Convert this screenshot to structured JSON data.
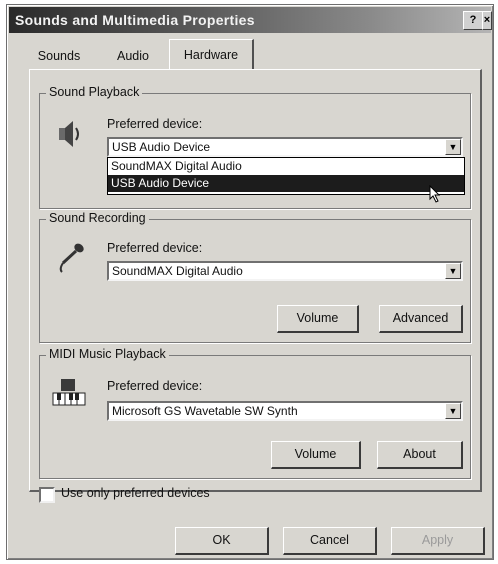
{
  "window": {
    "title": "Sounds and Multimedia Properties",
    "help_glyph": "?",
    "close_glyph": "×"
  },
  "tabs": [
    {
      "label": "Sounds"
    },
    {
      "label": "Audio"
    },
    {
      "label": "Hardware"
    }
  ],
  "playback": {
    "group_label": "Sound Playback",
    "preferred_label": "Preferred device:",
    "selected": "USB Audio Device",
    "options": [
      "SoundMAX Digital Audio",
      "USB Audio Device"
    ],
    "icon": "speaker-icon"
  },
  "recording": {
    "group_label": "Sound Recording",
    "preferred_label": "Preferred device:",
    "selected": "SoundMAX Digital Audio",
    "volume_label": "Volume",
    "advanced_label": "Advanced",
    "icon": "microphone-icon"
  },
  "midi": {
    "group_label": "MIDI Music Playback",
    "preferred_label": "Preferred device:",
    "selected": "Microsoft GS Wavetable SW Synth",
    "volume_label": "Volume",
    "about_label": "About",
    "icon": "midi-keyboard-icon"
  },
  "use_only_preferred": {
    "label": "Use only preferred devices",
    "checked": false
  },
  "footer": {
    "ok": "OK",
    "cancel": "Cancel",
    "apply": "Apply"
  }
}
